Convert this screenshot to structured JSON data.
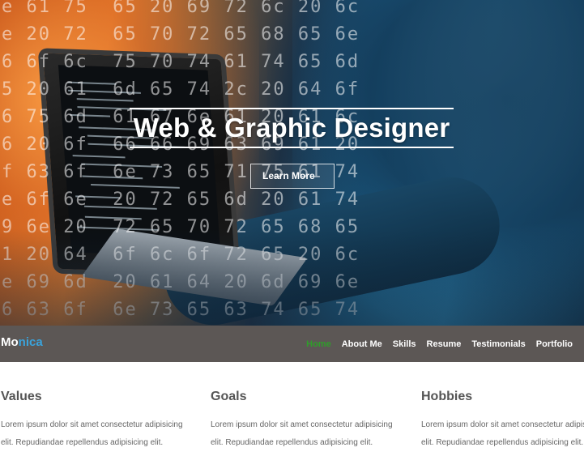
{
  "hero": {
    "title": "Web & Graphic Designer",
    "button_label": "Learn More",
    "background_code": "e 61 75  65 20 69 72 6c 20 6c\ne 20 72  65 70 72 65 68 65 6e\n6 6f 6c  75 70 74 61 74 65 6d\n5 20 61  6d 65 74 2c 20 64 6f\n6 75 6d  61 67 6e 61 20 61 6c\n6 20 6f  66 66 69 63 69 61 20\nf 63 6f  6e 73 65 71 75 61 74\ne 6f 6e  20 72 65 6d 20 61 74\n9 6e 20  72 65 70 72 65 68 65\n1 20 64  6f 6c 6f 72 65 20 6c\ne 69 6d  20 61 64 20 6d 69 6e\n6 63 6f  6e 73 65 63 74 65 74\n3 69 6e  67 20 65 6c 69 74 20"
  },
  "navbar": {
    "brand_part1": "Mo",
    "brand_part2": "nica",
    "links": [
      {
        "label": "Home",
        "active": true
      },
      {
        "label": "About Me",
        "active": false
      },
      {
        "label": "Skills",
        "active": false
      },
      {
        "label": "Resume",
        "active": false
      },
      {
        "label": "Testimonials",
        "active": false
      },
      {
        "label": "Portfolio",
        "active": false
      }
    ]
  },
  "sections": [
    {
      "heading": "Values",
      "line1": "Lorem ipsum dolor sit amet consectetur adipisicing",
      "line2": "elit. Repudiandae repellendus adipisicing elit."
    },
    {
      "heading": "Goals",
      "line1": "Lorem ipsum dolor sit amet consectetur adipisicing",
      "line2": "elit. Repudiandae repellendus adipisicing elit."
    },
    {
      "heading": "Hobbies",
      "line1": "Lorem ipsum dolor sit amet consectetur adipisicing",
      "line2": "elit. Repudiandae repellendus adipisicing elit."
    }
  ],
  "colors": {
    "navbar_bg": "#5c5755",
    "brand_accent": "#3aa3dc",
    "active_link": "#2f9e2a"
  }
}
